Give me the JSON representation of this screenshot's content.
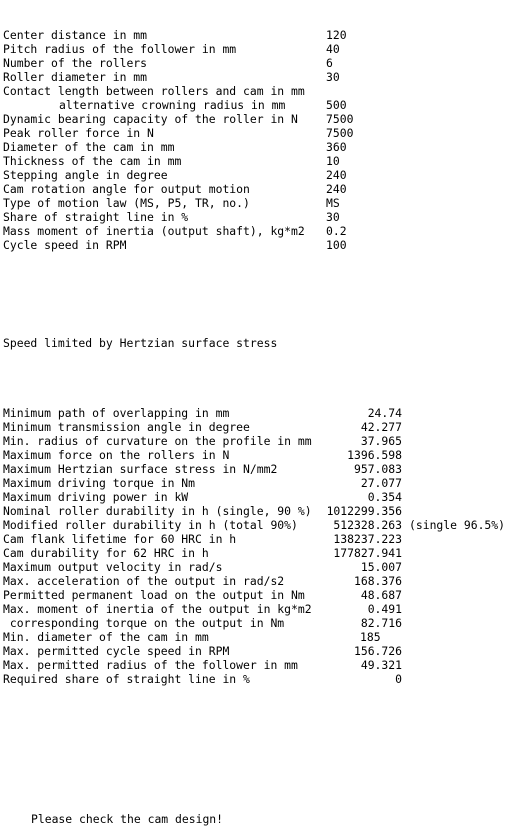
{
  "inputs": [
    {
      "label": "Center distance in mm",
      "value": "120"
    },
    {
      "label": "Pitch radius of the follower in mm",
      "value": "40"
    },
    {
      "label": "Number of the rollers",
      "value": "6"
    },
    {
      "label": "Roller diameter in mm",
      "value": "30"
    },
    {
      "label": "Contact length between rollers and cam in mm",
      "value": ""
    },
    {
      "label": "alternative crowning radius in mm",
      "value": "500",
      "indent": true
    },
    {
      "label": "Dynamic bearing capacity of the roller in N",
      "value": "7500"
    },
    {
      "label": "Peak roller force in N",
      "value": "7500"
    },
    {
      "label": "Diameter of the cam in mm",
      "value": "360"
    },
    {
      "label": "Thickness of the cam in mm",
      "value": "10"
    },
    {
      "label": "Stepping angle in degree",
      "value": "240"
    },
    {
      "label": "Cam rotation angle for output motion",
      "value": "240"
    },
    {
      "label": "Type of motion law (MS, P5, TR, no.)",
      "value": "MS"
    },
    {
      "label": "Share of straight line in %",
      "value": "30"
    },
    {
      "label": "Mass moment of inertia (output shaft), kg*m2",
      "value": "0.2"
    },
    {
      "label": "Cycle speed in RPM",
      "value": "100"
    }
  ],
  "status_message": "Speed limited by Hertzian surface stress",
  "results": [
    {
      "label": "Minimum path of overlapping in mm",
      "value": "24.74"
    },
    {
      "label": "Minimum transmission angle in degree",
      "value": "42.277"
    },
    {
      "label": "Min. radius of curvature on the profile in mm",
      "value": "37.965"
    },
    {
      "label": "Maximum force on the rollers in N",
      "value": "1396.598"
    },
    {
      "label": "Maximum Hertzian surface stress in N/mm2",
      "value": "957.083"
    },
    {
      "label": "Maximum driving torque in Nm",
      "value": "27.077"
    },
    {
      "label": "Maximum driving power in kW",
      "value": "0.354"
    },
    {
      "label": "Nominal roller durability in h (single, 90 %)",
      "value": "1012299.356"
    },
    {
      "label": "Modified roller durability in h (total 90%)",
      "value": "512328.263",
      "extra": "(single 96.5%)"
    },
    {
      "label": "Cam flank lifetime for 60 HRC in h",
      "value": "138237.223"
    },
    {
      "label": "Cam durability for 62 HRC in h",
      "value": "177827.941"
    },
    {
      "label": "Maximum output velocity in rad/s",
      "value": "15.007"
    },
    {
      "label": "Max. acceleration of the output in rad/s2",
      "value": "168.376"
    },
    {
      "label": "Permitted permanent load on the output in Nm",
      "value": "48.687"
    },
    {
      "label": "Max. moment of inertia of the output in kg*m2",
      "value": "0.491"
    },
    {
      "label": " corresponding torque on the output in Nm",
      "value": "82.716"
    },
    {
      "label": "Min. diameter of the cam in mm",
      "value": "185",
      "left": true
    },
    {
      "label": "Max. permitted cycle speed in RPM",
      "value": "156.726"
    },
    {
      "label": "Max. permitted radius of the follower in mm",
      "value": "49.321"
    },
    {
      "label": "Required share of straight line in %",
      "value": "0"
    }
  ],
  "warning": "Please check the cam design!"
}
